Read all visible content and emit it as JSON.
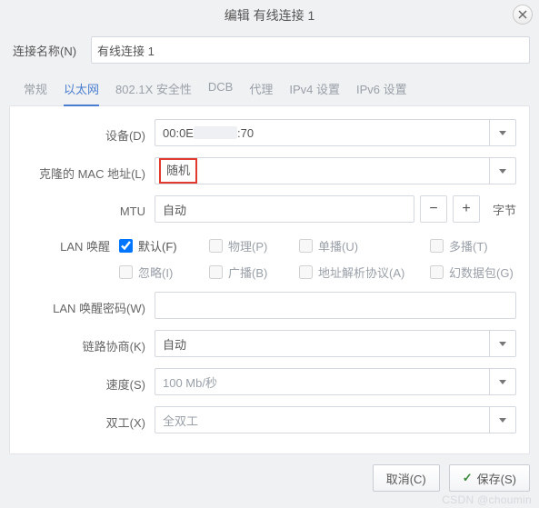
{
  "title": "编辑 有线连接 1",
  "conn_name_label": "连接名称(N)",
  "conn_name_value": "有线连接 1",
  "tabs": {
    "general": "常规",
    "ethernet": "以太网",
    "security": "802.1X 安全性",
    "dcb": "DCB",
    "proxy": "代理",
    "ipv4": "IPv4 设置",
    "ipv6": "IPv6 设置"
  },
  "form": {
    "device_label": "设备(D)",
    "device_value_prefix": "00:0E",
    "device_value_suffix": ":70",
    "clone_mac_label": "克隆的 MAC 地址(L)",
    "clone_mac_value": "随机",
    "mtu_label": "MTU",
    "mtu_value": "自动",
    "mtu_unit": "字节",
    "wol_label": "LAN 唤醒",
    "wol": {
      "default": "默认(F)",
      "phy": "物理(P)",
      "unicast": "单播(U)",
      "multicast": "多播(T)",
      "ignore": "忽略(I)",
      "broadcast": "广播(B)",
      "arp": "地址解析协议(A)",
      "magic": "幻数据包(G)"
    },
    "wol_pw_label": "LAN 唤醒密码(W)",
    "link_neg_label": "链路协商(K)",
    "link_neg_value": "自动",
    "speed_label": "速度(S)",
    "speed_value": "100 Mb/秒",
    "duplex_label": "双工(X)",
    "duplex_value": "全双工"
  },
  "buttons": {
    "cancel": "取消(C)",
    "save": "保存(S)"
  },
  "watermark": "CSDN @choumin"
}
